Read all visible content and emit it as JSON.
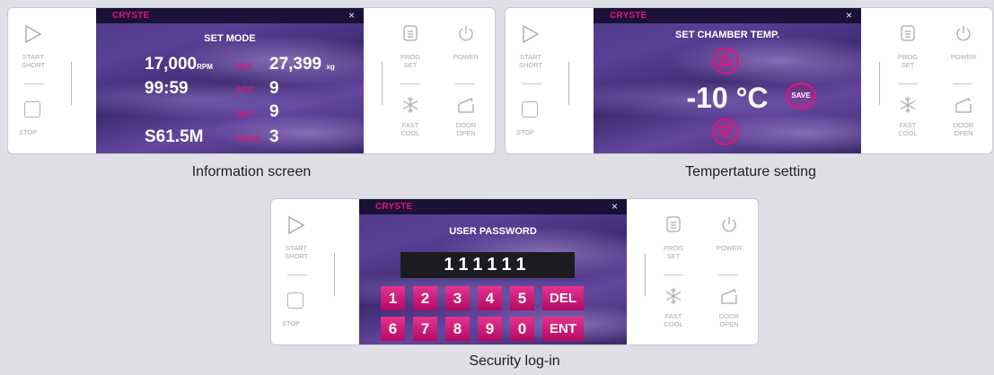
{
  "panels": {
    "info": {
      "caption": "Information screen",
      "brand": "CRYSTE",
      "close": "×",
      "title": "SET MODE",
      "speed": {
        "value": "17,000",
        "unit": "RPM"
      },
      "rcf": {
        "label": "RCF",
        "value": "27,399",
        "unit": "xg"
      },
      "time": "99:59",
      "acc": {
        "label": "ACC",
        "value": "9"
      },
      "dec": {
        "label": "DEC",
        "value": "9"
      },
      "rotor": "S61.5M",
      "prog": {
        "label": "PROG",
        "value": "3"
      }
    },
    "temp": {
      "caption": "Tempertature setting",
      "brand": "CRYSTE",
      "close": "×",
      "title": "SET CHAMBER TEMP.",
      "value": "-10 °C",
      "save_label": "SAVE"
    },
    "login": {
      "caption": "Security log-in",
      "brand": "CRYSTE",
      "close": "×",
      "title": "USER PASSWORD",
      "password": "111111",
      "keys_row1": [
        "1",
        "2",
        "3",
        "4",
        "5",
        "DEL"
      ],
      "keys_row2": [
        "6",
        "7",
        "8",
        "9",
        "0",
        "ENT"
      ]
    }
  },
  "controls": {
    "start_label_1": "START",
    "start_label_2": "SHORT",
    "stop_label": "STOP",
    "prog_label_1": "PROG",
    "prog_label_2": "SET",
    "power_label": "POWER",
    "fast_label_1": "FAST",
    "fast_label_2": "COOL",
    "door_label_1": "DOOR",
    "door_label_2": "OPEN"
  },
  "colors": {
    "accent": "#e0147a",
    "screen_bg": "#4d3a86",
    "panel_bg": "#ffffff",
    "page_bg": "#dfdfe6"
  }
}
